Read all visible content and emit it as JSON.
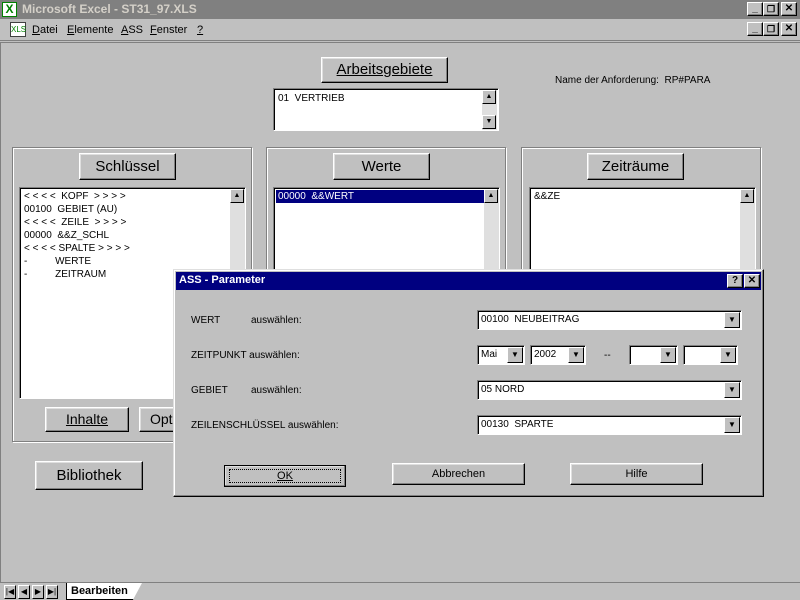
{
  "window": {
    "title": "Microsoft Excel - ST31_97.XLS",
    "minimize": "_",
    "restore": "🗗",
    "close": "✕"
  },
  "menu": {
    "items": [
      {
        "label": "Datei",
        "accel": "D",
        "rest": "atei"
      },
      {
        "label": "Elemente",
        "accel": "E",
        "rest": "lemente"
      },
      {
        "label": "ASS",
        "accel": "A",
        "rest": "SS"
      },
      {
        "label": "Fenster",
        "accel": "F",
        "rest": "enster"
      },
      {
        "label": "?",
        "accel": "?",
        "rest": ""
      }
    ]
  },
  "header": {
    "arbeitsgebiete_button": "Arbeitsgebiete",
    "arbeitsgebiete_items": [
      "01  VERTRIEB"
    ],
    "request_label": "Name der Anforderung:",
    "request_value": "RP#PARA"
  },
  "panels": {
    "schluessel": {
      "button": "Schlüssel",
      "items": [
        "< < < <  KOPF  > > > >",
        "00100  GEBIET (AU)",
        "< < < <  ZEILE  > > > >",
        "00000  &&Z_SCHL",
        "< < < < SPALTE > > > >",
        "-          WERTE",
        "-          ZEITRAUM"
      ],
      "inhalte_button": "Inhalte",
      "optionen_button": "Opt"
    },
    "werte": {
      "button": "Werte",
      "items": [
        "00000  &&WERT"
      ],
      "selected_index": 0
    },
    "zeitraeume": {
      "button": "Zeiträume",
      "items": [
        "&&ZE"
      ]
    }
  },
  "bibliothek_button": "Bibliothek",
  "dialog": {
    "title": "ASS - Parameter",
    "help_btn": "?",
    "close_btn": "✕",
    "fields": {
      "wert_label": "WERT",
      "wert_action": "auswählen:",
      "wert_value": "00100  NEUBEITRAG",
      "zeitpunkt_label": "ZEITPUNKT  auswählen:",
      "zeitpunkt_month": "Mai",
      "zeitpunkt_year": "2002",
      "zeitpunkt_sep": "--",
      "zeitpunkt_month2": "",
      "zeitpunkt_year2": "",
      "gebiet_label": "GEBIET",
      "gebiet_action": "auswählen:",
      "gebiet_value": "05 NORD",
      "zeilen_label": "ZEILENSCHLÜSSEL  auswählen:",
      "zeilen_value": "00130  SPARTE"
    },
    "ok_button": "OK",
    "abbrechen_button": "Abbrechen",
    "hilfe_button": "Hilfe"
  },
  "tabs": {
    "sheet_name": "Bearbeiten"
  },
  "colors": {
    "face": "#c0c0c0",
    "titlebar_inactive": "#808080",
    "dialog_title": "#000080",
    "selection": "#000080"
  }
}
